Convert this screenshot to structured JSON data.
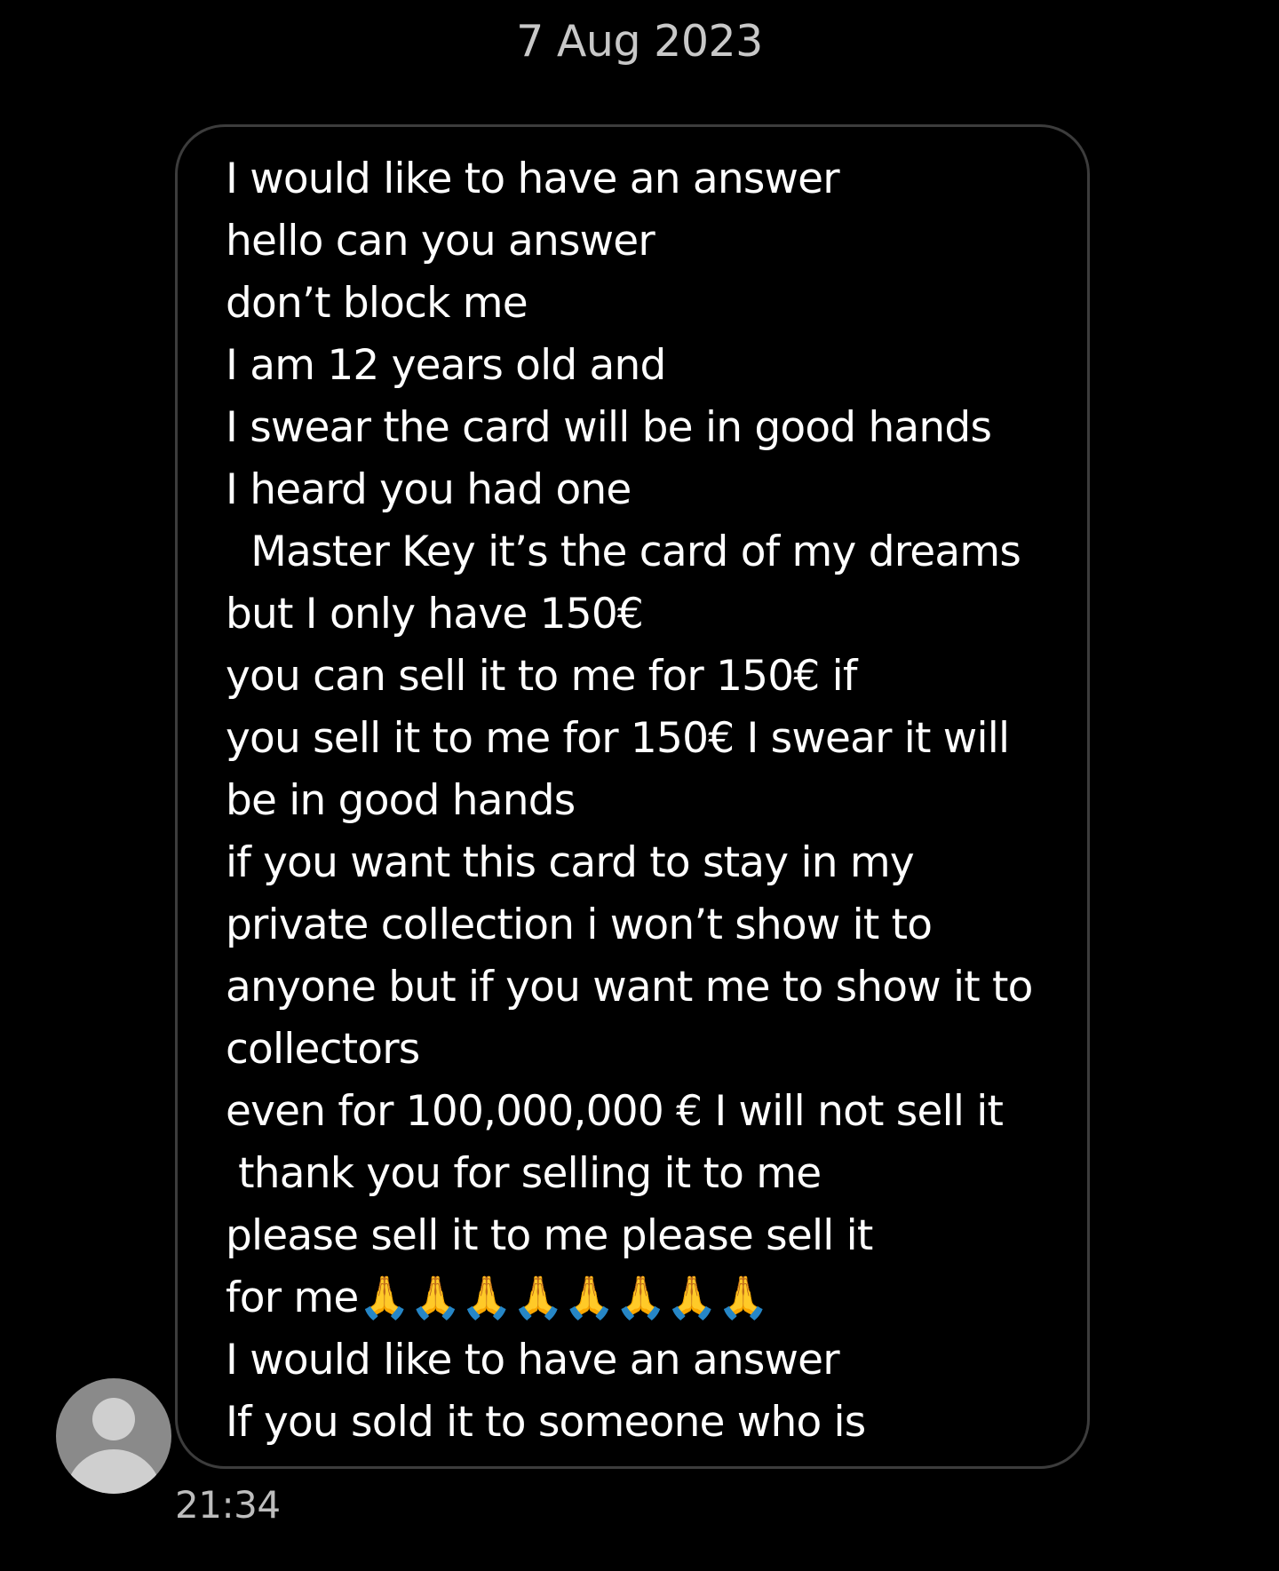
{
  "conversation": {
    "date": "7 Aug 2023",
    "message": {
      "lines": [
        "I would like to have an answer",
        "hello can you answer",
        "don’t block me",
        "I am 12 years old and",
        "I swear the card will be in good hands",
        "I heard you had one",
        "  Master Key it’s the card of my dreams",
        "but I only have 150€",
        "you can sell it to me for 150€ if",
        "you sell it to me for 150€ I swear it will",
        "be in good hands",
        "if you want this card to stay in my",
        "private collection i won’t show it to",
        "anyone but if you want me to show it to",
        "collectors",
        "even for 100,000,000 € I will not sell it",
        " thank you for selling it to me",
        "please sell it to me please sell it",
        "for me🙏🙏🙏🙏🙏🙏🙏🙏",
        "I would like to have an answer",
        "If you sold it to someone who is"
      ],
      "time": "21:34"
    },
    "sender": {
      "avatar_icon": "default-person-avatar-icon"
    }
  },
  "colors": {
    "background": "#000000",
    "bubble_border": "#3c3c3c",
    "text": "#ffffff",
    "secondary_text": "#c8c8c8",
    "avatar_bg": "#8a8a8a"
  }
}
